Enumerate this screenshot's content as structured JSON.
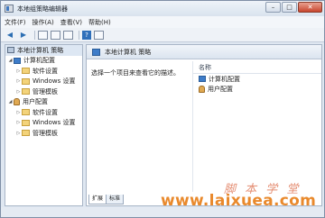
{
  "window": {
    "title": "本地组策略编辑器"
  },
  "menu": {
    "items": [
      "文件(F)",
      "操作(A)",
      "查看(V)",
      "帮助(H)"
    ]
  },
  "tree": {
    "root": "本地计算机 策略",
    "computer": {
      "label": "计算机配置",
      "children": [
        "软件设置",
        "Windows 设置",
        "管理模板"
      ]
    },
    "user": {
      "label": "用户配置",
      "children": [
        "软件设置",
        "Windows 设置",
        "管理模板"
      ]
    }
  },
  "details": {
    "header_title": "本地计算机 策略",
    "description": "选择一个项目来查看它的描述。",
    "column_name": "名称",
    "items": [
      "计算机配置",
      "用户配置"
    ]
  },
  "tabs": [
    "扩展",
    "标准"
  ],
  "watermark": {
    "brush_text": "脚 本 学 堂",
    "url": "www.laixuea.com"
  },
  "colors": {
    "accent": "#3d7cc9",
    "watermark": "#e9892c",
    "folder": "#f3d37a"
  }
}
